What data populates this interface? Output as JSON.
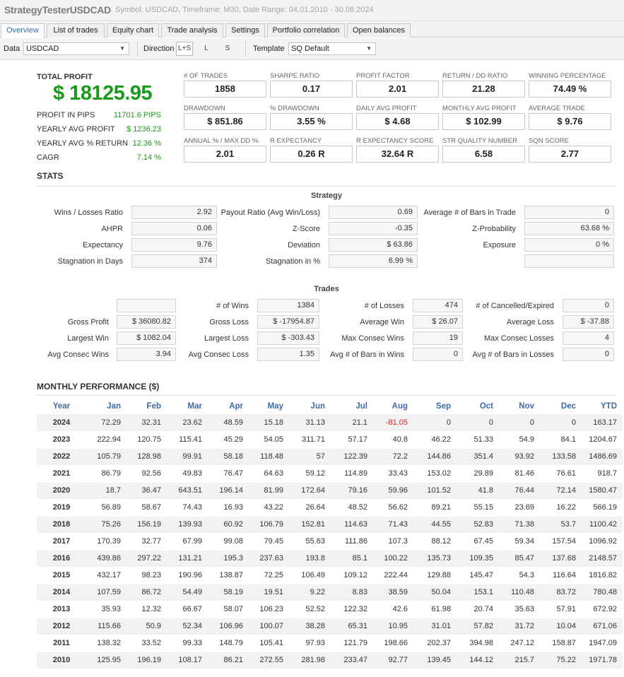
{
  "title": {
    "app_name": "StrategyTesterUSDCAD",
    "subtitle": "Symbol: USDCAD, Timeframe: M30, Date Range: 04.01.2010 - 30.08.2024"
  },
  "tabs": [
    {
      "label": "Overview",
      "active": true
    },
    {
      "label": "List of trades"
    },
    {
      "label": "Equity chart"
    },
    {
      "label": "Trade analysis"
    },
    {
      "label": "Settings"
    },
    {
      "label": "Portfolio correlation"
    },
    {
      "label": "Open balances"
    }
  ],
  "toolbar": {
    "data_label": "Data",
    "data_value": "USDCAD",
    "direction_label": "Direction",
    "direction_options": [
      "L+S",
      "L",
      "S"
    ],
    "direction_selected": "L+S",
    "template_label": "Template",
    "template_value": "SQ Default"
  },
  "summary": {
    "total_profit_label": "TOTAL PROFIT",
    "total_profit_value": "$ 18125.95",
    "rows": [
      {
        "label": "PROFIT IN PIPS",
        "value": "11701.6 PIPS"
      },
      {
        "label": "YEARLY AVG PROFIT",
        "value": "$ 1236.23"
      },
      {
        "label": "YEARLY AVG % RETURN",
        "value": "12.36 %"
      },
      {
        "label": "CAGR",
        "value": "7.14 %"
      }
    ],
    "metrics": [
      {
        "label": "# OF TRADES",
        "value": "1858"
      },
      {
        "label": "SHARPE RATIO",
        "value": "0.17"
      },
      {
        "label": "PROFIT FACTOR",
        "value": "2.01"
      },
      {
        "label": "RETURN / DD RATIO",
        "value": "21.28"
      },
      {
        "label": "WINNING PERCENTAGE",
        "value": "74.49 %"
      },
      {
        "label": "DRAWDOWN",
        "value": "$ 851.86"
      },
      {
        "label": "% DRAWDOWN",
        "value": "3.55 %"
      },
      {
        "label": "DAILY AVG PROFIT",
        "value": "$ 4.68"
      },
      {
        "label": "MONTHLY AVG PROFIT",
        "value": "$ 102.99"
      },
      {
        "label": "AVERAGE TRADE",
        "value": "$ 9.76"
      },
      {
        "label": "ANNUAL % / MAX DD %",
        "value": "2.01"
      },
      {
        "label": "R EXPECTANCY",
        "value": "0.26 R"
      },
      {
        "label": "R EXPECTANCY SCORE",
        "value": "32.64 R"
      },
      {
        "label": "STR QUALITY NUMBER",
        "value": "6.58"
      },
      {
        "label": "SQN SCORE",
        "value": "2.77"
      }
    ]
  },
  "stats": {
    "heading": "STATS",
    "strategy_heading": "Strategy",
    "strategy": [
      [
        {
          "label": "Wins / Losses Ratio",
          "value": "2.92"
        },
        {
          "label": "Payout Ratio (Avg Win/Loss)",
          "value": "0.69"
        },
        {
          "label": "Average # of Bars in Trade",
          "value": "0"
        }
      ],
      [
        {
          "label": "AHPR",
          "value": "0.06"
        },
        {
          "label": "Z-Score",
          "value": "-0.35"
        },
        {
          "label": "Z-Probability",
          "value": "63.68 %"
        }
      ],
      [
        {
          "label": "Expectancy",
          "value": "9.76"
        },
        {
          "label": "Deviation",
          "value": "$ 63.86"
        },
        {
          "label": "Exposure",
          "value": "0 %"
        }
      ],
      [
        {
          "label": "Stagnation in Days",
          "value": "374"
        },
        {
          "label": "Stagnation in %",
          "value": "6.99 %"
        },
        {
          "label": "",
          "value": ""
        }
      ]
    ],
    "trades_heading": "Trades",
    "trades": [
      [
        {
          "label": "",
          "value": ""
        },
        {
          "label": "# of Wins",
          "value": "1384"
        },
        {
          "label": "# of Losses",
          "value": "474"
        },
        {
          "label": "# of Cancelled/Expired",
          "value": "0"
        }
      ],
      [
        {
          "label": "Gross Profit",
          "value": "$ 36080.82"
        },
        {
          "label": "Gross Loss",
          "value": "$ -17954.87"
        },
        {
          "label": "Average Win",
          "value": "$ 26.07"
        },
        {
          "label": "Average Loss",
          "value": "$ -37.88"
        }
      ],
      [
        {
          "label": "Largest Win",
          "value": "$ 1082.04"
        },
        {
          "label": "Largest Loss",
          "value": "$ -303.43"
        },
        {
          "label": "Max Consec Wins",
          "value": "19"
        },
        {
          "label": "Max Consec Losses",
          "value": "4"
        }
      ],
      [
        {
          "label": "Avg Consec Wins",
          "value": "3.94"
        },
        {
          "label": "Avg Consec Loss",
          "value": "1.35"
        },
        {
          "label": "Avg # of Bars in Wins",
          "value": "0"
        },
        {
          "label": "Avg # of Bars in Losses",
          "value": "0"
        }
      ]
    ]
  },
  "monthly": {
    "heading": "MONTHLY PERFORMANCE ($)",
    "columns": [
      "Year",
      "Jan",
      "Feb",
      "Mar",
      "Apr",
      "May",
      "Jun",
      "Jul",
      "Aug",
      "Sep",
      "Oct",
      "Nov",
      "Dec",
      "YTD"
    ],
    "rows": [
      [
        "2024",
        "72.29",
        "32.31",
        "23.62",
        "48.59",
        "15.18",
        "31.13",
        "21.1",
        "-81.05",
        "0",
        "0",
        "0",
        "0",
        "163.17"
      ],
      [
        "2023",
        "222.94",
        "120.75",
        "115.41",
        "45.29",
        "54.05",
        "311.71",
        "57.17",
        "40.8",
        "46.22",
        "51.33",
        "54.9",
        "84.1",
        "1204.67"
      ],
      [
        "2022",
        "105.79",
        "128.98",
        "99.91",
        "58.18",
        "118.48",
        "57",
        "122.39",
        "72.2",
        "144.86",
        "351.4",
        "93.92",
        "133.58",
        "1486.69"
      ],
      [
        "2021",
        "86.79",
        "92.56",
        "49.83",
        "76.47",
        "64.63",
        "59.12",
        "114.89",
        "33.43",
        "153.02",
        "29.89",
        "81.46",
        "76.61",
        "918.7"
      ],
      [
        "2020",
        "18.7",
        "36.47",
        "643.51",
        "196.14",
        "81.99",
        "172.64",
        "79.16",
        "59.96",
        "101.52",
        "41.8",
        "76.44",
        "72.14",
        "1580.47"
      ],
      [
        "2019",
        "56.89",
        "58.67",
        "74.43",
        "16.93",
        "43.22",
        "26.64",
        "48.52",
        "56.62",
        "89.21",
        "55.15",
        "23.69",
        "16.22",
        "566.19"
      ],
      [
        "2018",
        "75.26",
        "156.19",
        "139.93",
        "60.92",
        "106.79",
        "152.81",
        "114.63",
        "71.43",
        "44.55",
        "52.83",
        "71.38",
        "53.7",
        "1100.42"
      ],
      [
        "2017",
        "170.39",
        "32.77",
        "67.99",
        "99.08",
        "79.45",
        "55.63",
        "111.86",
        "107.3",
        "88.12",
        "67.45",
        "59.34",
        "157.54",
        "1096.92"
      ],
      [
        "2016",
        "439.86",
        "297.22",
        "131.21",
        "195.3",
        "237.63",
        "193.8",
        "85.1",
        "100.22",
        "135.73",
        "109.35",
        "85.47",
        "137.68",
        "2148.57"
      ],
      [
        "2015",
        "432.17",
        "98.23",
        "190.96",
        "138.87",
        "72.25",
        "106.49",
        "109.12",
        "222.44",
        "129.88",
        "145.47",
        "54.3",
        "116.64",
        "1816.82"
      ],
      [
        "2014",
        "107.59",
        "86.72",
        "54.49",
        "58.19",
        "19.51",
        "9.22",
        "8.83",
        "38.59",
        "50.04",
        "153.1",
        "110.48",
        "83.72",
        "780.48"
      ],
      [
        "2013",
        "35.93",
        "12.32",
        "66.67",
        "58.07",
        "106.23",
        "52.52",
        "122.32",
        "42.6",
        "61.98",
        "20.74",
        "35.63",
        "57.91",
        "672.92"
      ],
      [
        "2012",
        "115.66",
        "50.9",
        "52.34",
        "106.96",
        "100.07",
        "38.28",
        "65.31",
        "10.95",
        "31.01",
        "57.82",
        "31.72",
        "10.04",
        "671.06"
      ],
      [
        "2011",
        "138.32",
        "33.52",
        "99.33",
        "148.79",
        "105.41",
        "97.93",
        "121.79",
        "198.66",
        "202.37",
        "394.98",
        "247.12",
        "158.87",
        "1947.09"
      ],
      [
        "2010",
        "125.95",
        "196.19",
        "108.17",
        "86.21",
        "272.55",
        "281.98",
        "233.47",
        "92.77",
        "139.45",
        "144.12",
        "215.7",
        "75.22",
        "1971.78"
      ]
    ]
  },
  "colors": {
    "profit_green": "#1a9a1a",
    "negative_red": "#e01f1f",
    "header_blue": "#3d6aa6",
    "tab_active_text": "#2f6fb0"
  }
}
